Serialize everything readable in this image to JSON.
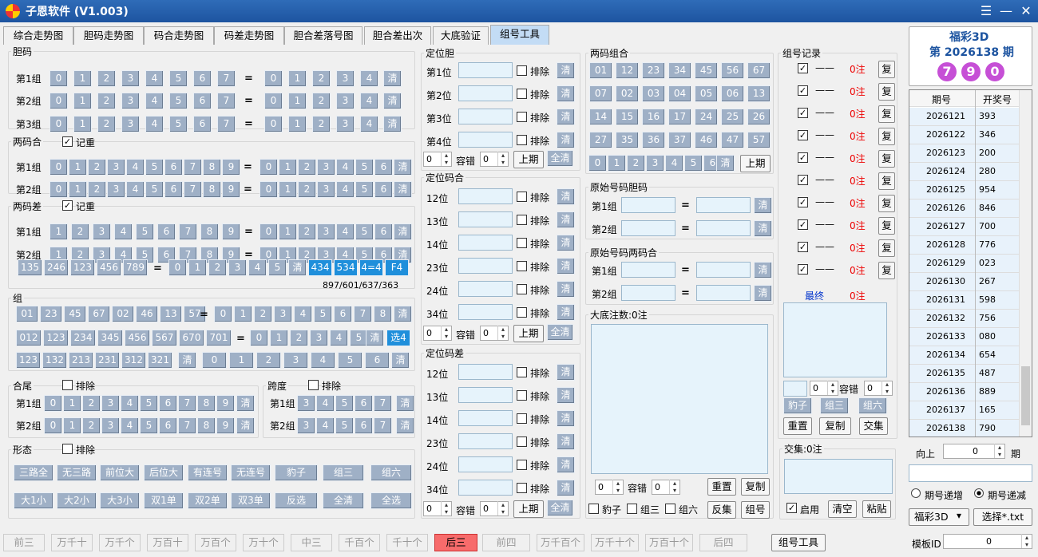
{
  "app": {
    "title": "子恩软件 (V1.003)"
  },
  "tabs": [
    "综合走势图",
    "胆码走势图",
    "码合走势图",
    "码差走势图",
    "胆合差落号图",
    "胆合差出次",
    "大底验证",
    "组号工具"
  ],
  "labels": {
    "dm": "胆码",
    "g1": "第1组",
    "g2": "第2组",
    "g3": "第3组",
    "lmh": "两码合",
    "lmc": "两码差",
    "jz": "记重",
    "zu": "组",
    "hw": "合尾",
    "kd": "跨度",
    "pc": "排除",
    "xt": "形态",
    "qing": "清",
    "eq": "=",
    "stats": "897/601/637/363",
    "dwd": "定位胆",
    "dwmh": "定位码合",
    "dwmc": "定位码差",
    "rongcuo": "容错",
    "shangqi": "上期",
    "quanqing": "全清",
    "lmzh": "两码组合",
    "yshmdm": "原始号码胆码",
    "yshmlmh": "原始号码两码合",
    "dadi": "大底注数:0注",
    "chongzhi": "重置",
    "fuzhi": "复制",
    "baozi": "豹子",
    "zusan": "组三",
    "zuliu": "组六",
    "fanji": "反集",
    "zuhao": "组号",
    "zhjl": "组号记录",
    "zhu0": "0注",
    "dash": "——",
    "fu": "复",
    "zuizhong": "最终",
    "jiaoji": "交集",
    "jiaojizs": "交集:0注",
    "qiyong": "启用",
    "qingkong": "清空",
    "zhantie": "粘贴",
    "xiangshang": "向上",
    "qi": "期",
    "dizeng": "期号递增",
    "dijian": "期号递减",
    "lottery": "福彩3D",
    "xuanze": "选择*.txt",
    "mbid": "模板ID",
    "zhgj": "组号工具",
    "zero": "0"
  },
  "pos_dan": [
    "第1位",
    "第2位",
    "第3位",
    "第4位"
  ],
  "pos_he": [
    "12位",
    "13位",
    "14位",
    "23位",
    "24位",
    "34位"
  ],
  "digits": [
    "0",
    "1",
    "2",
    "3",
    "4",
    "5",
    "6",
    "7",
    "8",
    "9"
  ],
  "lc_row3": [
    "135",
    "246",
    "123",
    "456",
    "789"
  ],
  "lc_blue": [
    "434",
    "534",
    "4=4",
    "F4"
  ],
  "zu_r1": [
    "01",
    "23",
    "45",
    "67",
    "02",
    "46",
    "13",
    "57"
  ],
  "zu_r2": [
    "012",
    "123",
    "234",
    "345",
    "456",
    "567",
    "670",
    "701"
  ],
  "zu_r3": [
    "123",
    "132",
    "213",
    "231",
    "312",
    "321"
  ],
  "xt_r1": [
    "三路全",
    "无三路",
    "前位大",
    "后位大",
    "有连号",
    "无连号",
    "豹子",
    "组三",
    "组六"
  ],
  "xt_r2": [
    "大1小",
    "大2小",
    "大3小",
    "双1单",
    "双2单",
    "双3单",
    "反选",
    "全清",
    "全选"
  ],
  "lmzh": [
    "01",
    "12",
    "23",
    "34",
    "45",
    "56",
    "67",
    "07",
    "02",
    "03",
    "04",
    "05",
    "06",
    "13",
    "14",
    "15",
    "16",
    "17",
    "24",
    "25",
    "26",
    "27",
    "35",
    "36",
    "37",
    "46",
    "47",
    "57"
  ],
  "panel": {
    "lottery": "福彩3D",
    "issue": "第 2026138 期",
    "balls": [
      "7",
      "9",
      "0"
    ]
  },
  "table": {
    "headers": [
      "期号",
      "开奖号"
    ],
    "rows": [
      [
        "2026121",
        "393"
      ],
      [
        "2026122",
        "346"
      ],
      [
        "2026123",
        "200"
      ],
      [
        "2026124",
        "280"
      ],
      [
        "2026125",
        "954"
      ],
      [
        "2026126",
        "846"
      ],
      [
        "2026127",
        "700"
      ],
      [
        "2026128",
        "776"
      ],
      [
        "2026129",
        "023"
      ],
      [
        "2026130",
        "267"
      ],
      [
        "2026131",
        "598"
      ],
      [
        "2026132",
        "756"
      ],
      [
        "2026133",
        "080"
      ],
      [
        "2026134",
        "654"
      ],
      [
        "2026135",
        "487"
      ],
      [
        "2026136",
        "889"
      ],
      [
        "2026137",
        "165"
      ],
      [
        "2026138",
        "790"
      ]
    ]
  },
  "bottom": [
    "前三",
    "万千十",
    "万千个",
    "万百十",
    "万百个",
    "万十个",
    "中三",
    "千百个",
    "千十个",
    "后三",
    "前四",
    "万千百个",
    "万千十个",
    "万百十个",
    "后四"
  ],
  "colors": {
    "title": "#1d54a0",
    "active": "#f76b6b",
    "ball": "#c64fd6",
    "blue": "#1f8fdb"
  }
}
